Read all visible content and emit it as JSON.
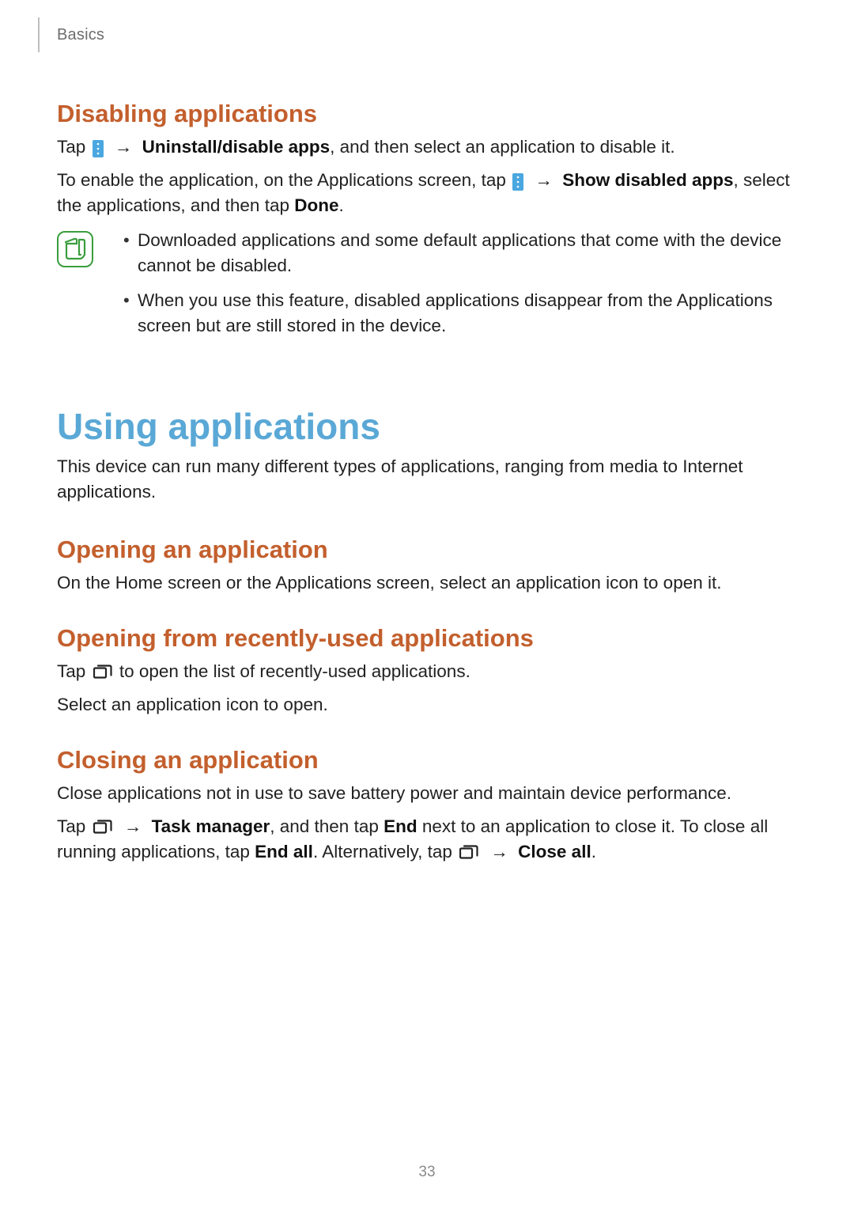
{
  "header": {
    "breadcrumb": "Basics"
  },
  "sec_disabling": {
    "title": "Disabling applications",
    "p1": {
      "tap": "Tap",
      "arrow": "→",
      "bold1": "Uninstall/disable apps",
      "rest": ", and then select an application to disable it."
    },
    "p2": {
      "pre": "To enable the application, on the Applications screen, tap",
      "arrow": "→",
      "bold1": "Show disabled apps",
      "mid": ", select the applications, and then tap ",
      "bold2": "Done",
      "end": "."
    },
    "notes": [
      "Downloaded applications and some default applications that come with the device cannot be disabled.",
      "When you use this feature, disabled applications disappear from the Applications screen but are still stored in the device."
    ]
  },
  "sec_using": {
    "title": "Using applications",
    "intro": "This device can run many different types of applications, ranging from media to Internet applications."
  },
  "sec_opening": {
    "title": "Opening an application",
    "body": "On the Home screen or the Applications screen, select an application icon to open it."
  },
  "sec_recent": {
    "title": "Opening from recently-used applications",
    "p1": {
      "tap": "Tap",
      "rest": "to open the list of recently-used applications."
    },
    "p2": "Select an application icon to open."
  },
  "sec_closing": {
    "title": "Closing an application",
    "p1": "Close applications not in use to save battery power and maintain device performance.",
    "p2": {
      "tap": "Tap",
      "arrow": "→",
      "bold1": "Task manager",
      "mid1": ", and then tap ",
      "bold2": "End",
      "mid2": " next to an application to close it. To close all running applications, tap ",
      "bold3": "End all",
      "mid3": ". Alternatively, tap ",
      "arrow2": "→",
      "bold4": "Close all",
      "end": "."
    }
  },
  "page_number": "33"
}
